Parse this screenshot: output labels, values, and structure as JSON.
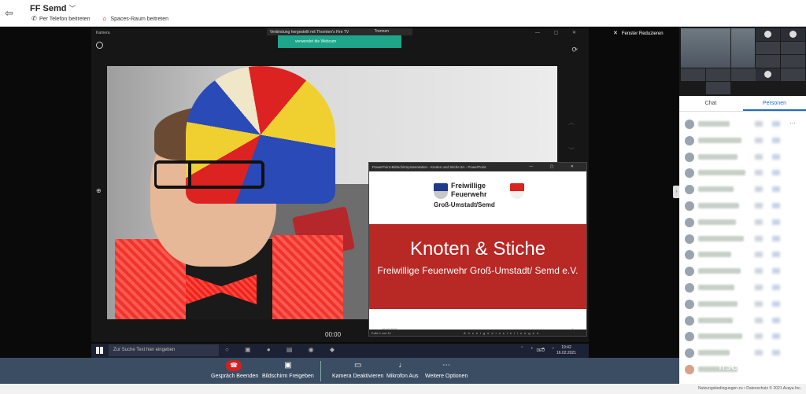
{
  "header": {
    "meeting_title": "FF Semd",
    "phone_join": "Per Telefon beitreten",
    "room_join": "Spaces-Raum beitreten"
  },
  "camera_window": {
    "title": "Kamera",
    "timer": "00:00"
  },
  "notice": {
    "text": "Verbindung hergestellt mit Thornten's Fire TV",
    "button": "Trennen",
    "webcam_text": "verwendet die Webcam"
  },
  "presentation": {
    "window_title": "PowerPoint-Bildschirmpräsentation - Knoten und Stiche 8A - PowerPoint",
    "logo_line1": "Freiwillige",
    "logo_line2": "Feuerwehr",
    "logo_line3": "Groß-Umstadt/Semd",
    "heading": "Knoten & Stiche",
    "subheading": "Freiwillige Feuerwehr Groß-Umstadt/ Semd e.V.",
    "date": "16.02.2021",
    "page": "1",
    "footer_left": "Folie 1 von 11",
    "footer_mid": "Anzeigeeinstellungen"
  },
  "taskbar": {
    "search_placeholder": "Zur Suche Text hier eingeben",
    "language": "DEU",
    "time": "19:42",
    "date": "16.02.2021"
  },
  "controls": {
    "end_call": "Gespräch Beenden",
    "share_screen": "Bildschirm Freigeben",
    "camera_off": "Kamera Deaktivieren",
    "mic_off": "Mikrofon Aus",
    "more": "Weitere Optionen"
  },
  "side": {
    "reduce_window": "Fenster Reduzieren",
    "tab_chat": "Chat",
    "tab_people": "Personen"
  },
  "footer": {
    "legal": "Nutzungsbedingungen zu • Datenschutz    © 2021 Avaya Inc."
  },
  "watermark": "ffsemd.de",
  "colors": {
    "end_call": "#d32020",
    "control_bar": "#3a4d63",
    "slide_band": "#b82825",
    "active_tab": "#1e6bd0"
  }
}
